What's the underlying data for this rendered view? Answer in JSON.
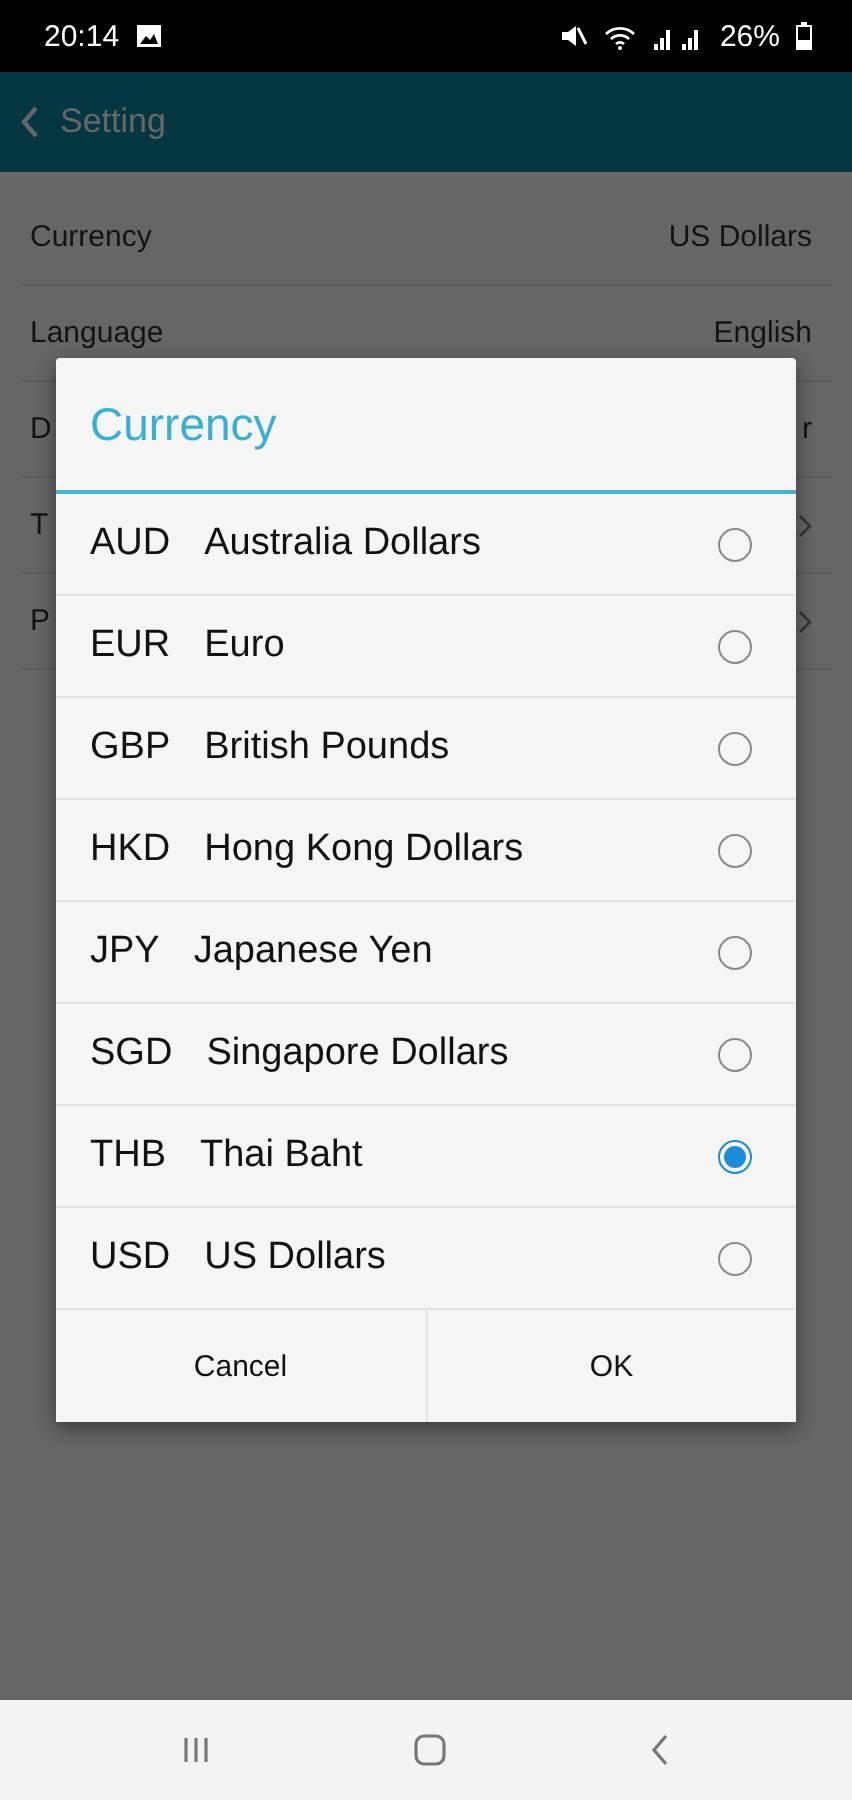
{
  "status_bar": {
    "time": "20:14",
    "battery": "26%"
  },
  "app_bar": {
    "title": "Setting"
  },
  "settings": [
    {
      "label": "Currency",
      "value": "US Dollars",
      "kind": "value"
    },
    {
      "label": "Language",
      "value": "English",
      "kind": "value"
    },
    {
      "label": "D",
      "value": "r",
      "kind": "value"
    },
    {
      "label": "T",
      "kind": "link"
    },
    {
      "label": "P",
      "kind": "link"
    }
  ],
  "dialog": {
    "title": "Currency",
    "options": [
      {
        "code": "AUD",
        "name": "Australia Dollars",
        "selected": false
      },
      {
        "code": "EUR",
        "name": "Euro",
        "selected": false
      },
      {
        "code": "GBP",
        "name": "British Pounds",
        "selected": false
      },
      {
        "code": "HKD",
        "name": "Hong Kong Dollars",
        "selected": false
      },
      {
        "code": "JPY",
        "name": "Japanese Yen",
        "selected": false
      },
      {
        "code": "SGD",
        "name": "Singapore Dollars",
        "selected": false
      },
      {
        "code": "THB",
        "name": "Thai Baht",
        "selected": true
      },
      {
        "code": "USD",
        "name": "US Dollars",
        "selected": false
      }
    ],
    "buttons": [
      "Cancel",
      "OK"
    ]
  }
}
